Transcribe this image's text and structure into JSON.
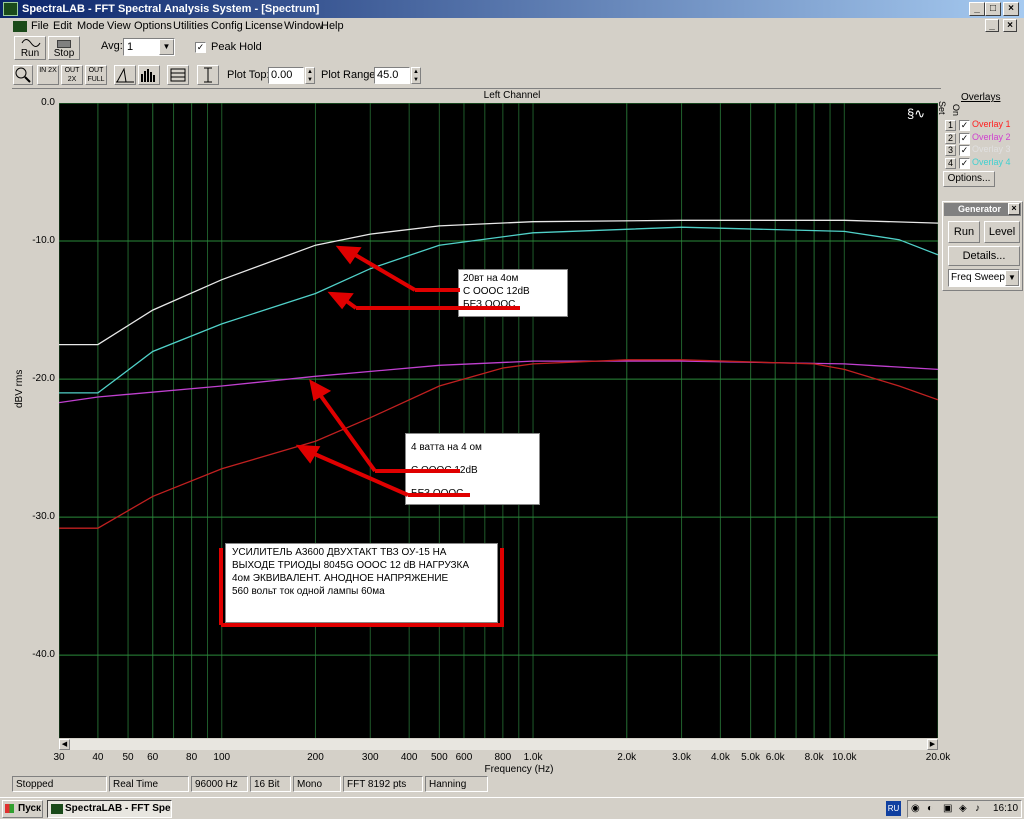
{
  "window": {
    "title": "SpectraLAB - FFT Spectral Analysis System - [Spectrum]"
  },
  "menu": [
    "File",
    "Edit",
    "Mode",
    "View",
    "Options",
    "Utilities",
    "Config",
    "License",
    "Window",
    "Help"
  ],
  "toolbar": {
    "run": "Run",
    "stop": "Stop",
    "avg_label": "Avg:",
    "avg_value": "1",
    "peak_hold": "Peak Hold",
    "plot_top_label": "Plot Top:",
    "plot_top_value": "0.00",
    "plot_range_label": "Plot Range:",
    "plot_range_value": "45.0",
    "zoom_in": "IN 2X",
    "zoom_out": "OUT 2X",
    "zoom_full": "OUT FULL"
  },
  "channel_title": "Left Channel",
  "overlays": {
    "header": "Overlays",
    "col_set": "Set",
    "col_on": "On",
    "items": [
      {
        "num": "1",
        "label": "Overlay 1",
        "color": "#ff2020"
      },
      {
        "num": "2",
        "label": "Overlay 2",
        "color": "#d040d0"
      },
      {
        "num": "3",
        "label": "Overlay 3",
        "color": "#e0e0e0"
      },
      {
        "num": "4",
        "label": "Overlay 4",
        "color": "#40d0d0"
      }
    ],
    "options": "Options..."
  },
  "generator": {
    "title": "Generator",
    "run": "Run",
    "level": "Level",
    "details": "Details...",
    "mode": "Freq Sweep"
  },
  "annotations": {
    "a1": {
      "l1": "20вт   на   4ом",
      "l2": "С   ОООС  12dB",
      "l3": "БЕЗ    ОООС"
    },
    "a2": {
      "l1": "4 ватта   на  4  ом",
      "l2": "С   ОООС  12dB",
      "l3": "БЕЗ   ОООС"
    },
    "a3": {
      "l1": "УСИЛИТЕЛЬ  А3600  ДВУХТАКТ  ТВЗ  ОУ-15   НА",
      "l2": "ВЫХОДЕ  ТРИОДЫ  8045G  ОООС  12 dB  НАГРУЗКА",
      "l3": "4ом  ЭКВИВАЛЕНТ.  АНОДНОЕ  НАПРЯЖЕНИЕ",
      "l4": "560 вольт   ток  одной лампы 60ма"
    }
  },
  "status": {
    "state": "Stopped",
    "mode": "Real Time",
    "rate": "96000 Hz",
    "bits": "16 Bit",
    "channels": "Mono",
    "fft": "FFT 8192 pts",
    "window": "Hanning"
  },
  "taskbar": {
    "start": "Пуск",
    "app": "SpectraLAB - FFT Spe...",
    "lang": "RU",
    "clock": "16:10"
  },
  "chart_data": {
    "type": "line",
    "scale_x": "log",
    "xlabel": "Frequency (Hz)",
    "ylabel": "dBV rms",
    "xlim": [
      30,
      20000
    ],
    "ylim": [
      -46,
      0
    ],
    "y_ticks": [
      "0.0",
      "-10.0",
      "-20.0",
      "-30.0",
      "-40.0"
    ],
    "x_ticks": [
      {
        "v": 30,
        "t": "30"
      },
      {
        "v": 40,
        "t": "40"
      },
      {
        "v": 50,
        "t": "50"
      },
      {
        "v": 60,
        "t": "60"
      },
      {
        "v": 80,
        "t": "80"
      },
      {
        "v": 100,
        "t": "100"
      },
      {
        "v": 200,
        "t": "200"
      },
      {
        "v": 300,
        "t": "300"
      },
      {
        "v": 400,
        "t": "400"
      },
      {
        "v": 500,
        "t": "500"
      },
      {
        "v": 600,
        "t": "600"
      },
      {
        "v": 800,
        "t": "800"
      },
      {
        "v": 1000,
        "t": "1.0k"
      },
      {
        "v": 2000,
        "t": "2.0k"
      },
      {
        "v": 3000,
        "t": "3.0k"
      },
      {
        "v": 4000,
        "t": "4.0k"
      },
      {
        "v": 5000,
        "t": "5.0k"
      },
      {
        "v": 6000,
        "t": "6.0k"
      },
      {
        "v": 8000,
        "t": "8.0k"
      },
      {
        "v": 10000,
        "t": "10.0k"
      },
      {
        "v": 20000,
        "t": "20.0k"
      }
    ],
    "series": [
      {
        "color": "#e8e8e8",
        "points": [
          [
            30,
            -17.5
          ],
          [
            40,
            -17.5
          ],
          [
            60,
            -15
          ],
          [
            100,
            -12.8
          ],
          [
            200,
            -10.3
          ],
          [
            300,
            -9.5
          ],
          [
            500,
            -8.9
          ],
          [
            1000,
            -8.6
          ],
          [
            3000,
            -8.5
          ],
          [
            10000,
            -8.5
          ],
          [
            20000,
            -8.7
          ]
        ]
      },
      {
        "color": "#50d0c8",
        "points": [
          [
            30,
            -21
          ],
          [
            40,
            -21
          ],
          [
            60,
            -18
          ],
          [
            100,
            -16
          ],
          [
            200,
            -13.8
          ],
          [
            300,
            -12
          ],
          [
            500,
            -10.3
          ],
          [
            1000,
            -9.4
          ],
          [
            3000,
            -9
          ],
          [
            10000,
            -9.3
          ],
          [
            15000,
            -9.9
          ],
          [
            20000,
            -11
          ]
        ]
      },
      {
        "color": "#c040d0",
        "points": [
          [
            30,
            -21.7
          ],
          [
            40,
            -21.3
          ],
          [
            100,
            -20.5
          ],
          [
            200,
            -19.8
          ],
          [
            500,
            -19
          ],
          [
            1000,
            -18.7
          ],
          [
            3000,
            -18.7
          ],
          [
            10000,
            -18.9
          ],
          [
            20000,
            -19.3
          ]
        ]
      },
      {
        "color": "#c02020",
        "points": [
          [
            30,
            -30.8
          ],
          [
            40,
            -30.8
          ],
          [
            60,
            -28.5
          ],
          [
            100,
            -26.5
          ],
          [
            200,
            -24.5
          ],
          [
            300,
            -22.8
          ],
          [
            500,
            -20.5
          ],
          [
            800,
            -19.2
          ],
          [
            1000,
            -18.9
          ],
          [
            2000,
            -18.6
          ],
          [
            3000,
            -18.6
          ],
          [
            8000,
            -18.9
          ],
          [
            10000,
            -19.3
          ],
          [
            15000,
            -20.5
          ],
          [
            20000,
            -21.5
          ]
        ]
      }
    ]
  }
}
